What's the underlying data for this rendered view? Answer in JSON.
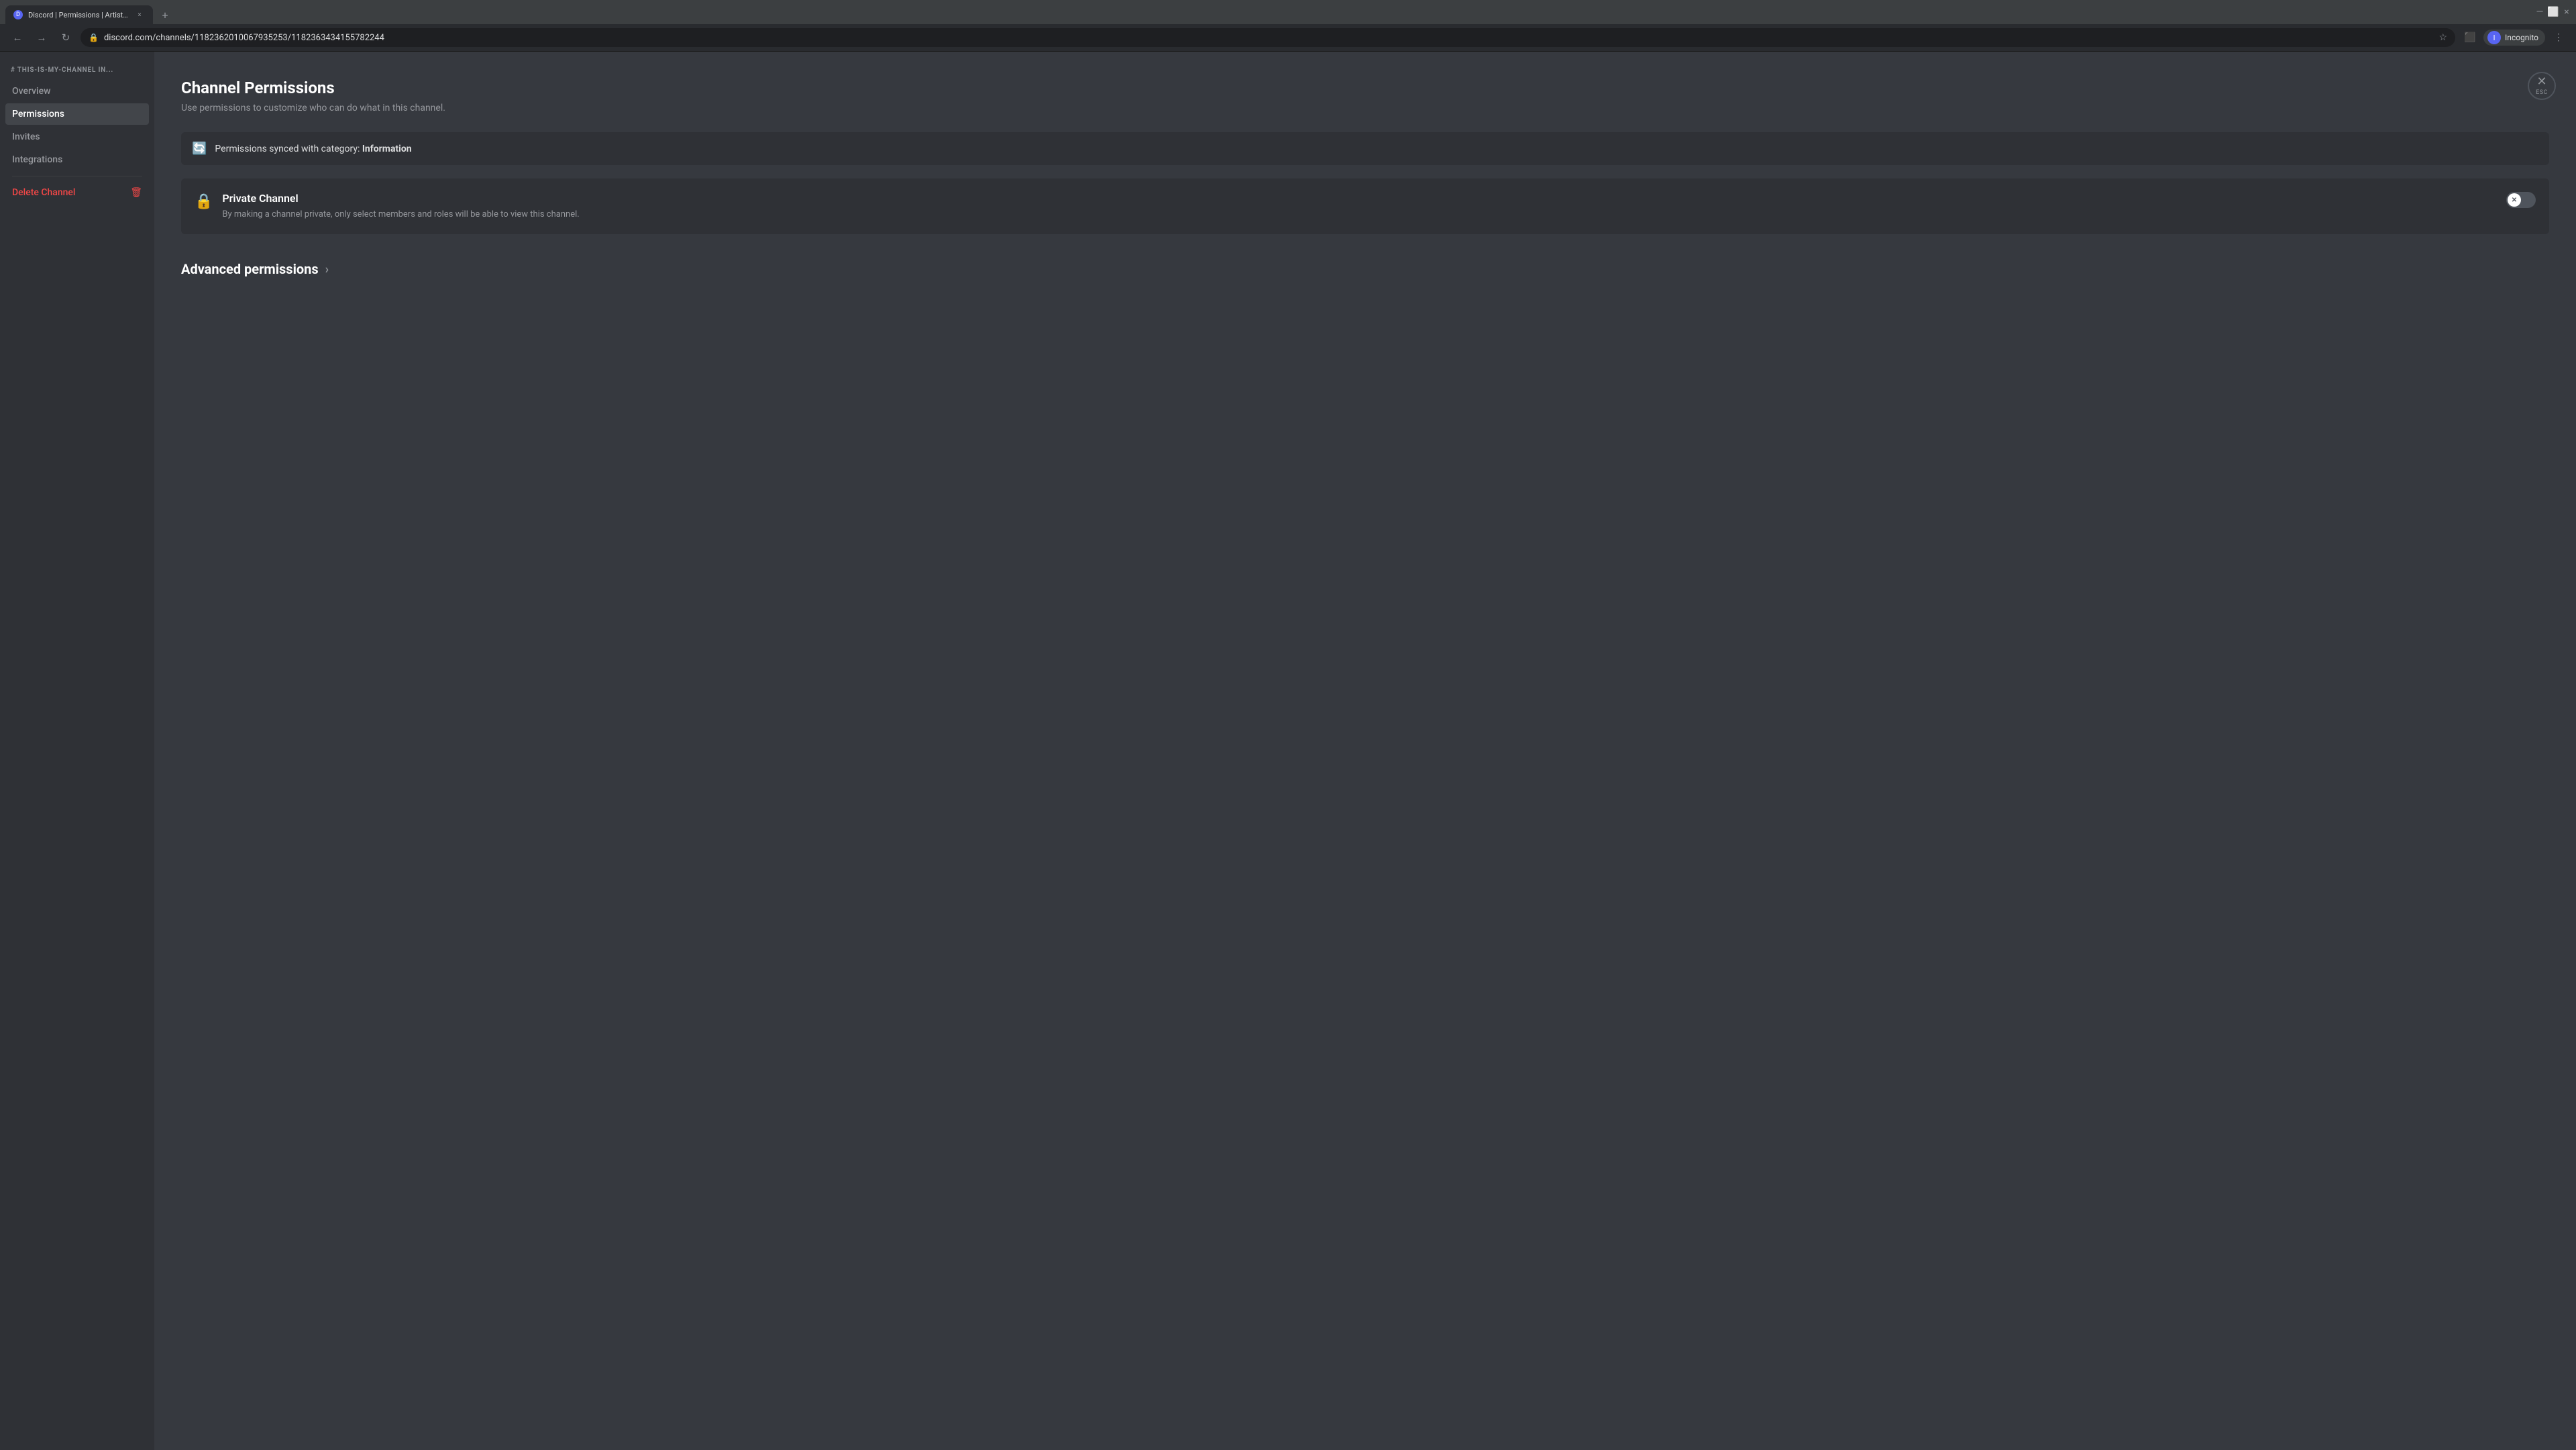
{
  "browser": {
    "tab": {
      "favicon": "D",
      "title": "Discord | Permissions | Artists Di",
      "close_label": "×"
    },
    "new_tab_label": "+",
    "window_controls": {
      "minimize": "—",
      "maximize": "⬜",
      "close": "×"
    },
    "url": "discord.com/channels/1182362010067935253/1182363434155782244",
    "incognito_label": "Incognito",
    "nav": {
      "back": "←",
      "forward": "→",
      "refresh": "↻",
      "star": "☆",
      "menu": "⋮"
    }
  },
  "sidebar": {
    "channel_label": "# THIS-IS-MY-CHANNEL IN...",
    "items": [
      {
        "id": "overview",
        "label": "Overview",
        "active": false
      },
      {
        "id": "permissions",
        "label": "Permissions",
        "active": true
      },
      {
        "id": "invites",
        "label": "Invites",
        "active": false
      },
      {
        "id": "integrations",
        "label": "Integrations",
        "active": false
      }
    ],
    "divider": true,
    "delete_label": "Delete Channel",
    "delete_icon": "🗑"
  },
  "content": {
    "title": "Channel Permissions",
    "subtitle": "Use permissions to customize who can do what in this channel.",
    "sync_notice": {
      "text_prefix": "Permissions synced with category: ",
      "category_name": "Information"
    },
    "private_channel": {
      "title": "Private Channel",
      "description": "By making a channel private, only select members and roles will be able to view this channel.",
      "toggle_state": "off"
    },
    "advanced_permissions": {
      "label": "Advanced permissions",
      "chevron": "›"
    },
    "close_btn": {
      "x_label": "✕",
      "esc_label": "ESC"
    }
  },
  "colors": {
    "accent": "#5865f2",
    "sidebar_bg": "#2f3136",
    "content_bg": "#36393f",
    "active_item": "#42454a",
    "muted": "#96989d",
    "danger": "#f04747"
  }
}
